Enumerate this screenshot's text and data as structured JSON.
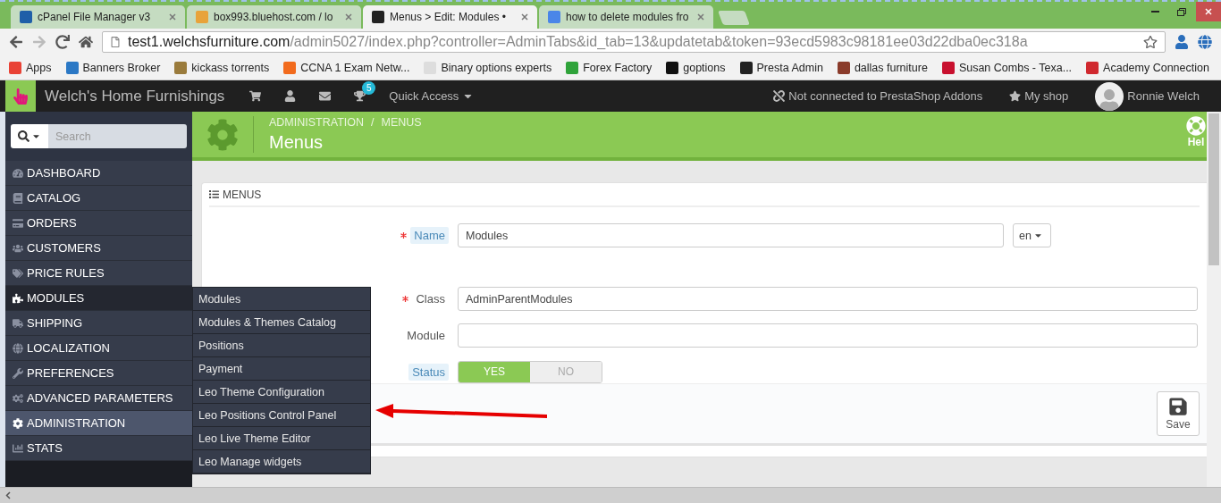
{
  "browser": {
    "tabs": [
      {
        "title": "cPanel File Manager v3",
        "selected": false,
        "color": "#1f5fa8"
      },
      {
        "title": "box993.bluehost.com / lo",
        "selected": false,
        "color": "#e8a33a"
      },
      {
        "title": "Menus > Edit: Modules •",
        "selected": true,
        "color": "#222222"
      },
      {
        "title": "how to delete modules fro",
        "selected": false,
        "color": "#4a86e8"
      }
    ],
    "address": {
      "host": "test1.welchsfurniture.com",
      "path": "/admin5027/index.php?controller=AdminTabs&id_tab=13&updatetab&token=93ecd5983c98181ee03d22dba0ec318a"
    },
    "bookmarks": [
      {
        "label": "Apps",
        "color": "#e94235"
      },
      {
        "label": "Banners Broker",
        "color": "#2b78c5"
      },
      {
        "label": "kickass torrents",
        "color": "#9a7b3c"
      },
      {
        "label": "CCNA 1 Exam Netw...",
        "color": "#f26b1d"
      },
      {
        "label": "Binary options experts",
        "color": "#dddddd"
      },
      {
        "label": "Forex Factory",
        "color": "#2fa33a"
      },
      {
        "label": "goptions",
        "color": "#111111"
      },
      {
        "label": "Presta Admin",
        "color": "#222222"
      },
      {
        "label": "dallas furniture",
        "color": "#8a3b2a"
      },
      {
        "label": "Susan Combs - Texa...",
        "color": "#c8102e"
      },
      {
        "label": "Academy Connection",
        "color": "#d0282e"
      }
    ]
  },
  "header": {
    "brand": "Welch's Home Furnishings",
    "badge": "5",
    "quick_access": "Quick Access",
    "addons": "Not connected to PrestaShop Addons",
    "my_shop": "My shop",
    "user": "Ronnie Welch"
  },
  "sidebar": {
    "search": {
      "placeholder": "Search"
    },
    "items": [
      {
        "label": "DASHBOARD",
        "selected": false,
        "hovered": false
      },
      {
        "label": "CATALOG",
        "selected": false,
        "hovered": false
      },
      {
        "label": "ORDERS",
        "selected": false,
        "hovered": false
      },
      {
        "label": "CUSTOMERS",
        "selected": false,
        "hovered": false
      },
      {
        "label": "PRICE RULES",
        "selected": false,
        "hovered": false
      },
      {
        "label": "MODULES",
        "selected": false,
        "hovered": true
      },
      {
        "label": "SHIPPING",
        "selected": false,
        "hovered": false
      },
      {
        "label": "LOCALIZATION",
        "selected": false,
        "hovered": false
      },
      {
        "label": "PREFERENCES",
        "selected": false,
        "hovered": false
      },
      {
        "label": "ADVANCED PARAMETERS",
        "selected": false,
        "hovered": false
      },
      {
        "label": "ADMINISTRATION",
        "selected": true,
        "hovered": false
      },
      {
        "label": "STATS",
        "selected": false,
        "hovered": false
      }
    ],
    "submenu": [
      "Modules",
      "Modules & Themes Catalog",
      "Positions",
      "Payment",
      "Leo Theme Configuration",
      "Leo Positions Control Panel",
      "Leo Live Theme Editor",
      "Leo Manage widgets"
    ]
  },
  "page_header": {
    "breadcrumb": [
      "ADMINISTRATION",
      "MENUS"
    ],
    "separator": "/",
    "title": "Menus",
    "help": "Hel"
  },
  "panel": {
    "heading": "MENUS",
    "fields": [
      {
        "kind": "text",
        "label": "Name",
        "required": true,
        "hint": true,
        "value": "Modules",
        "language": "en"
      },
      {
        "kind": "text",
        "label": "Class",
        "required": true,
        "hint": false,
        "value": "AdminParentModules"
      },
      {
        "kind": "text",
        "label": "Module",
        "required": false,
        "hint": false
      },
      {
        "kind": "toggle",
        "label": "Status",
        "required": false,
        "hint": true,
        "options": [
          "YES",
          "NO"
        ],
        "on": true
      }
    ],
    "save": "Save"
  }
}
